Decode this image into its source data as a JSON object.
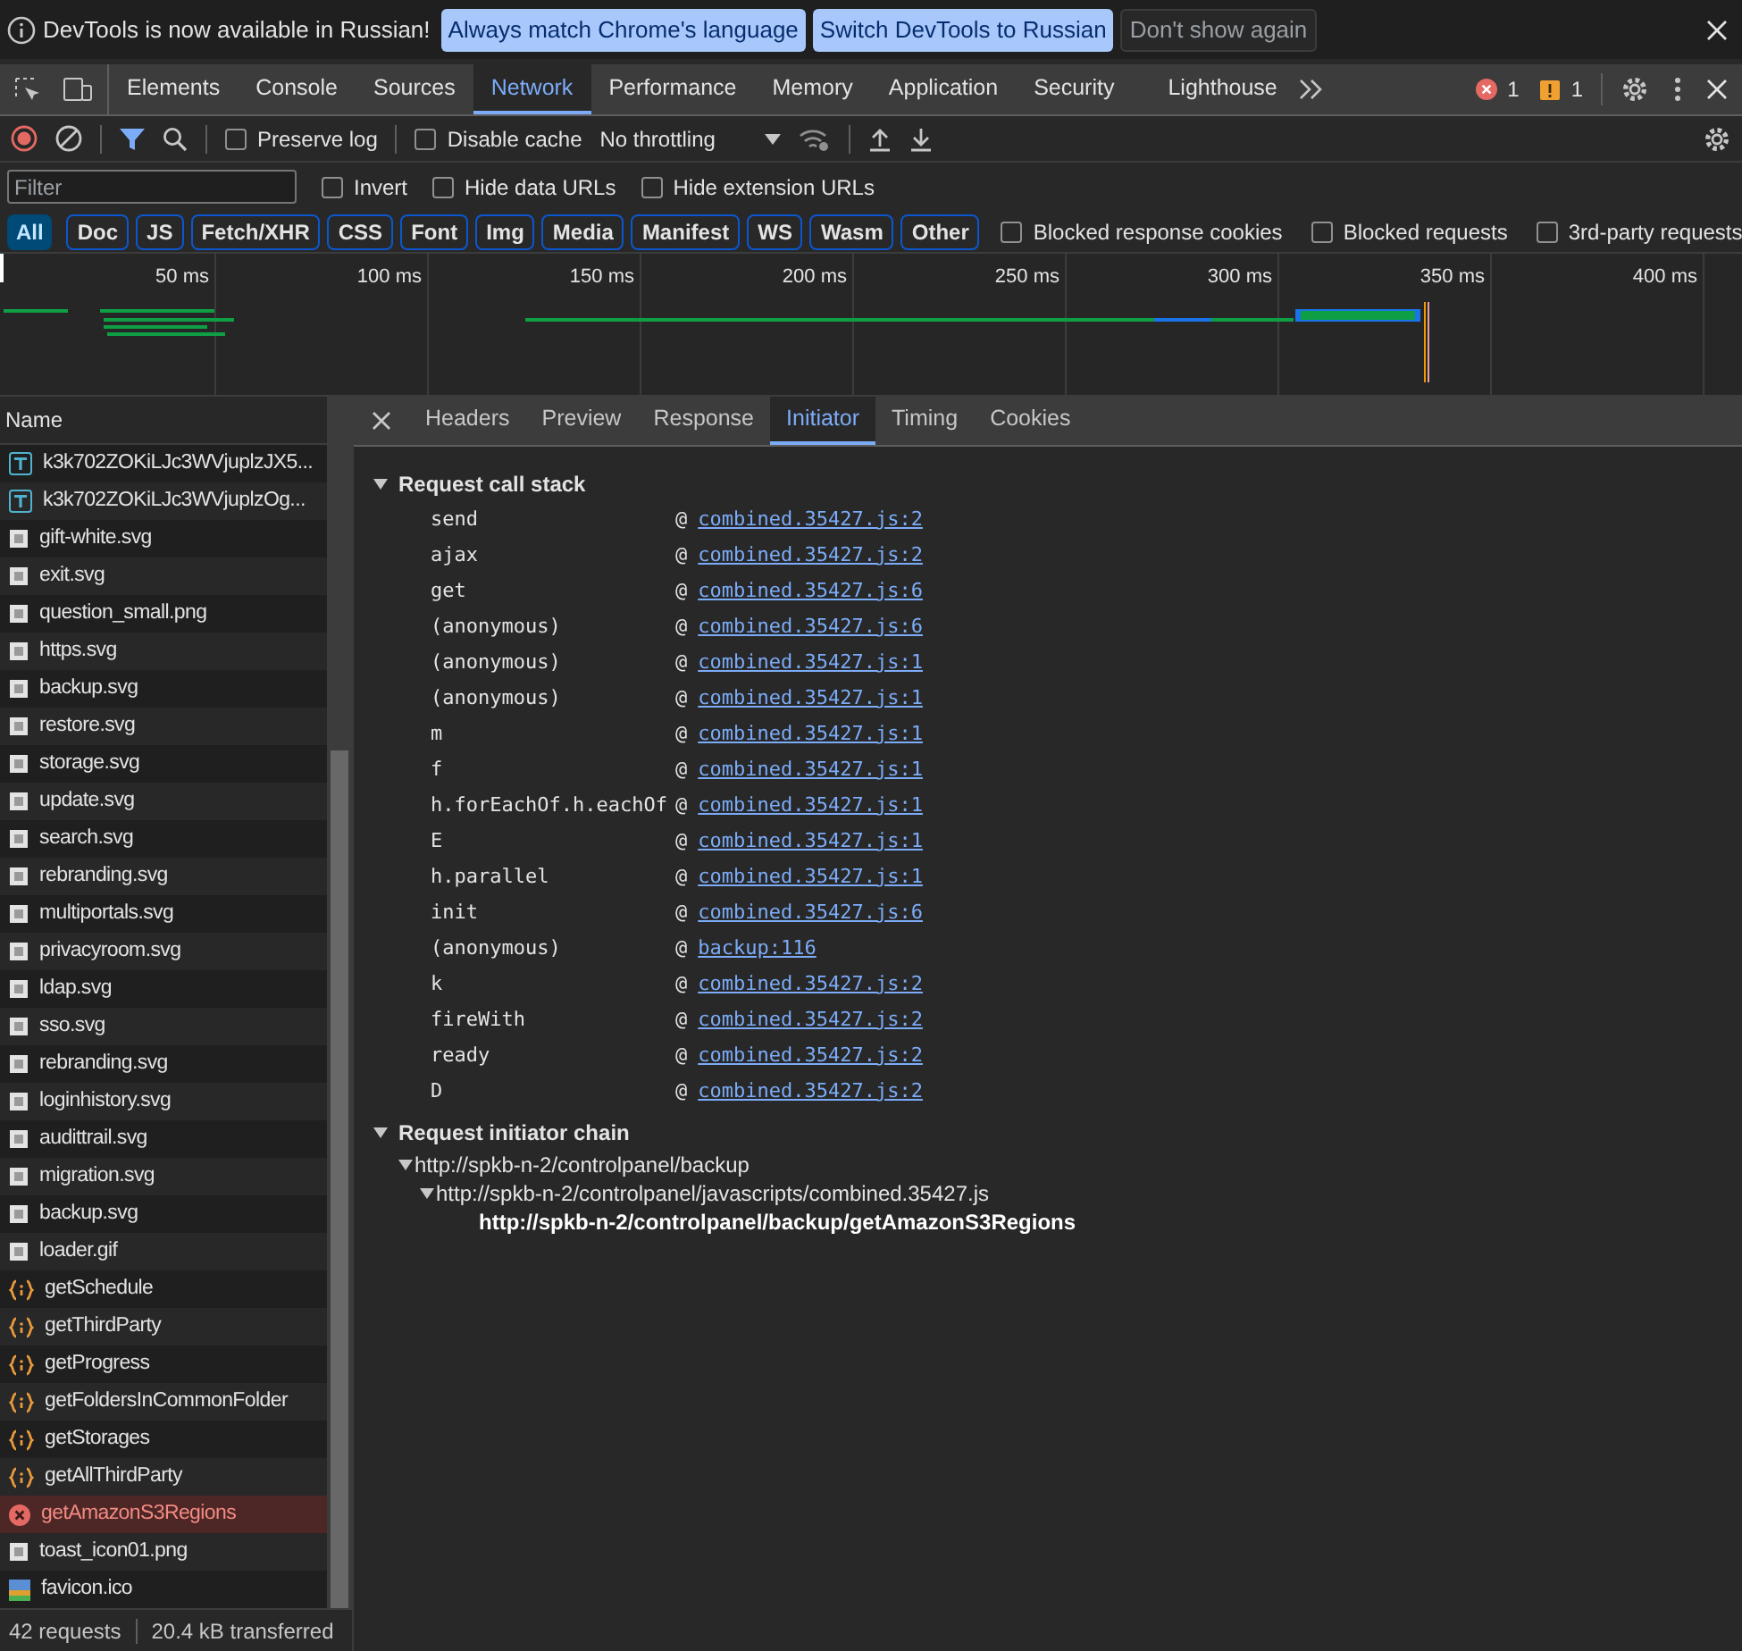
{
  "infobar": {
    "message": "DevTools is now available in Russian!",
    "buttons": [
      {
        "label": "Always match Chrome's language",
        "kind": "primary"
      },
      {
        "label": "Switch DevTools to Russian",
        "kind": "primary"
      },
      {
        "label": "Don't show again",
        "kind": "plain"
      }
    ]
  },
  "panel_tabs": [
    {
      "label": "Elements",
      "selected": false
    },
    {
      "label": "Console",
      "selected": false
    },
    {
      "label": "Sources",
      "selected": false
    },
    {
      "label": "Network",
      "selected": true
    },
    {
      "label": "Performance",
      "selected": false
    },
    {
      "label": "Memory",
      "selected": false
    },
    {
      "label": "Application",
      "selected": false
    },
    {
      "label": "Security",
      "selected": false
    },
    {
      "label": "Lighthouse",
      "selected": false
    }
  ],
  "errors_count": "1",
  "warnings_count": "1",
  "toolbar": {
    "recording": true,
    "preserve_log": {
      "label": "Preserve log",
      "checked": false
    },
    "disable_cache": {
      "label": "Disable cache",
      "checked": false
    },
    "throttling": "No throttling"
  },
  "filter": {
    "placeholder": "Filter",
    "options": [
      {
        "label": "Invert",
        "checked": false
      },
      {
        "label": "Hide data URLs",
        "checked": false
      },
      {
        "label": "Hide extension URLs",
        "checked": false
      }
    ]
  },
  "type_filters": [
    {
      "label": "All",
      "selected": true
    },
    {
      "label": "Doc",
      "selected": false
    },
    {
      "label": "JS",
      "selected": false
    },
    {
      "label": "Fetch/XHR",
      "selected": false
    },
    {
      "label": "CSS",
      "selected": false
    },
    {
      "label": "Font",
      "selected": false
    },
    {
      "label": "Img",
      "selected": false
    },
    {
      "label": "Media",
      "selected": false
    },
    {
      "label": "Manifest",
      "selected": false
    },
    {
      "label": "WS",
      "selected": false
    },
    {
      "label": "Wasm",
      "selected": false
    },
    {
      "label": "Other",
      "selected": false
    }
  ],
  "type_options": [
    {
      "label": "Blocked response cookies",
      "checked": false
    },
    {
      "label": "Blocked requests",
      "checked": false
    },
    {
      "label": "3rd-party requests",
      "checked": false
    }
  ],
  "timeline_ticks": [
    "50 ms",
    "100 ms",
    "150 ms",
    "200 ms",
    "250 ms",
    "300 ms",
    "350 ms",
    "400 ms"
  ],
  "requests": {
    "column": "Name",
    "rows": [
      {
        "name": "k3k702ZOKiLJc3WVjuplzJX5...",
        "kind": "font",
        "selected": false
      },
      {
        "name": "k3k702ZOKiLJc3WVjuplzOg...",
        "kind": "font",
        "selected": false
      },
      {
        "name": "gift-white.svg",
        "kind": "image",
        "selected": false
      },
      {
        "name": "exit.svg",
        "kind": "image",
        "selected": false
      },
      {
        "name": "question_small.png",
        "kind": "image",
        "selected": false
      },
      {
        "name": "https.svg",
        "kind": "image",
        "selected": false
      },
      {
        "name": "backup.svg",
        "kind": "image",
        "selected": false
      },
      {
        "name": "restore.svg",
        "kind": "image",
        "selected": false
      },
      {
        "name": "storage.svg",
        "kind": "image",
        "selected": false
      },
      {
        "name": "update.svg",
        "kind": "image",
        "selected": false
      },
      {
        "name": "search.svg",
        "kind": "image",
        "selected": false
      },
      {
        "name": "rebranding.svg",
        "kind": "image",
        "selected": false
      },
      {
        "name": "multiportals.svg",
        "kind": "image",
        "selected": false
      },
      {
        "name": "privacyroom.svg",
        "kind": "image",
        "selected": false
      },
      {
        "name": "ldap.svg",
        "kind": "image",
        "selected": false
      },
      {
        "name": "sso.svg",
        "kind": "image",
        "selected": false
      },
      {
        "name": "rebranding.svg",
        "kind": "image",
        "selected": false
      },
      {
        "name": "loginhistory.svg",
        "kind": "image",
        "selected": false
      },
      {
        "name": "audittrail.svg",
        "kind": "image",
        "selected": false
      },
      {
        "name": "migration.svg",
        "kind": "image",
        "selected": false
      },
      {
        "name": "backup.svg",
        "kind": "image",
        "selected": false
      },
      {
        "name": "loader.gif",
        "kind": "image",
        "selected": false
      },
      {
        "name": "getSchedule",
        "kind": "fetch",
        "selected": false
      },
      {
        "name": "getThirdParty",
        "kind": "fetch",
        "selected": false
      },
      {
        "name": "getProgress",
        "kind": "fetch",
        "selected": false
      },
      {
        "name": "getFoldersInCommonFolder",
        "kind": "fetch",
        "selected": false
      },
      {
        "name": "getStorages",
        "kind": "fetch",
        "selected": false
      },
      {
        "name": "getAllThirdParty",
        "kind": "fetch",
        "selected": false
      },
      {
        "name": "getAmazonS3Regions",
        "kind": "error",
        "selected": true
      },
      {
        "name": "toast_icon01.png",
        "kind": "image",
        "selected": false
      },
      {
        "name": "favicon.ico",
        "kind": "favicon",
        "selected": false
      }
    ]
  },
  "status_bar": {
    "requests": "42 requests",
    "transferred": "20.4 kB transferred"
  },
  "detail_tabs": [
    {
      "label": "Headers",
      "selected": false
    },
    {
      "label": "Preview",
      "selected": false
    },
    {
      "label": "Response",
      "selected": false
    },
    {
      "label": "Initiator",
      "selected": true
    },
    {
      "label": "Timing",
      "selected": false
    },
    {
      "label": "Cookies",
      "selected": false
    }
  ],
  "call_stack": {
    "title": "Request call stack",
    "expanded": true,
    "frames": [
      {
        "function": "send",
        "at": "@",
        "location": "combined.35427.js:2"
      },
      {
        "function": "ajax",
        "at": "@",
        "location": "combined.35427.js:2"
      },
      {
        "function": "get",
        "at": "@",
        "location": "combined.35427.js:6"
      },
      {
        "function": "(anonymous)",
        "at": "@",
        "location": "combined.35427.js:6"
      },
      {
        "function": "(anonymous)",
        "at": "@",
        "location": "combined.35427.js:1"
      },
      {
        "function": "(anonymous)",
        "at": "@",
        "location": "combined.35427.js:1"
      },
      {
        "function": "m",
        "at": "@",
        "location": "combined.35427.js:1"
      },
      {
        "function": "f",
        "at": "@",
        "location": "combined.35427.js:1"
      },
      {
        "function": "h.forEachOf.h.eachOf",
        "at": "@",
        "location": "combined.35427.js:1"
      },
      {
        "function": "E",
        "at": "@",
        "location": "combined.35427.js:1"
      },
      {
        "function": "h.parallel",
        "at": "@",
        "location": "combined.35427.js:1"
      },
      {
        "function": "init",
        "at": "@",
        "location": "combined.35427.js:6"
      },
      {
        "function": "(anonymous)",
        "at": "@",
        "location": "backup:116"
      },
      {
        "function": "k",
        "at": "@",
        "location": "combined.35427.js:2"
      },
      {
        "function": "fireWith",
        "at": "@",
        "location": "combined.35427.js:2"
      },
      {
        "function": "ready",
        "at": "@",
        "location": "combined.35427.js:2"
      },
      {
        "function": "D",
        "at": "@",
        "location": "combined.35427.js:2"
      }
    ]
  },
  "initiator_chain": {
    "title": "Request initiator chain",
    "expanded": true,
    "nodes": [
      {
        "url": "http://spkb-n-2/controlpanel/backup",
        "expanded": true,
        "children": [
          {
            "url": "http://spkb-n-2/controlpanel/javascripts/combined.35427.js",
            "expanded": true,
            "children": [
              {
                "url": "http://spkb-n-2/controlpanel/backup/getAmazonS3Regions",
                "current": true
              }
            ]
          }
        ]
      }
    ]
  }
}
